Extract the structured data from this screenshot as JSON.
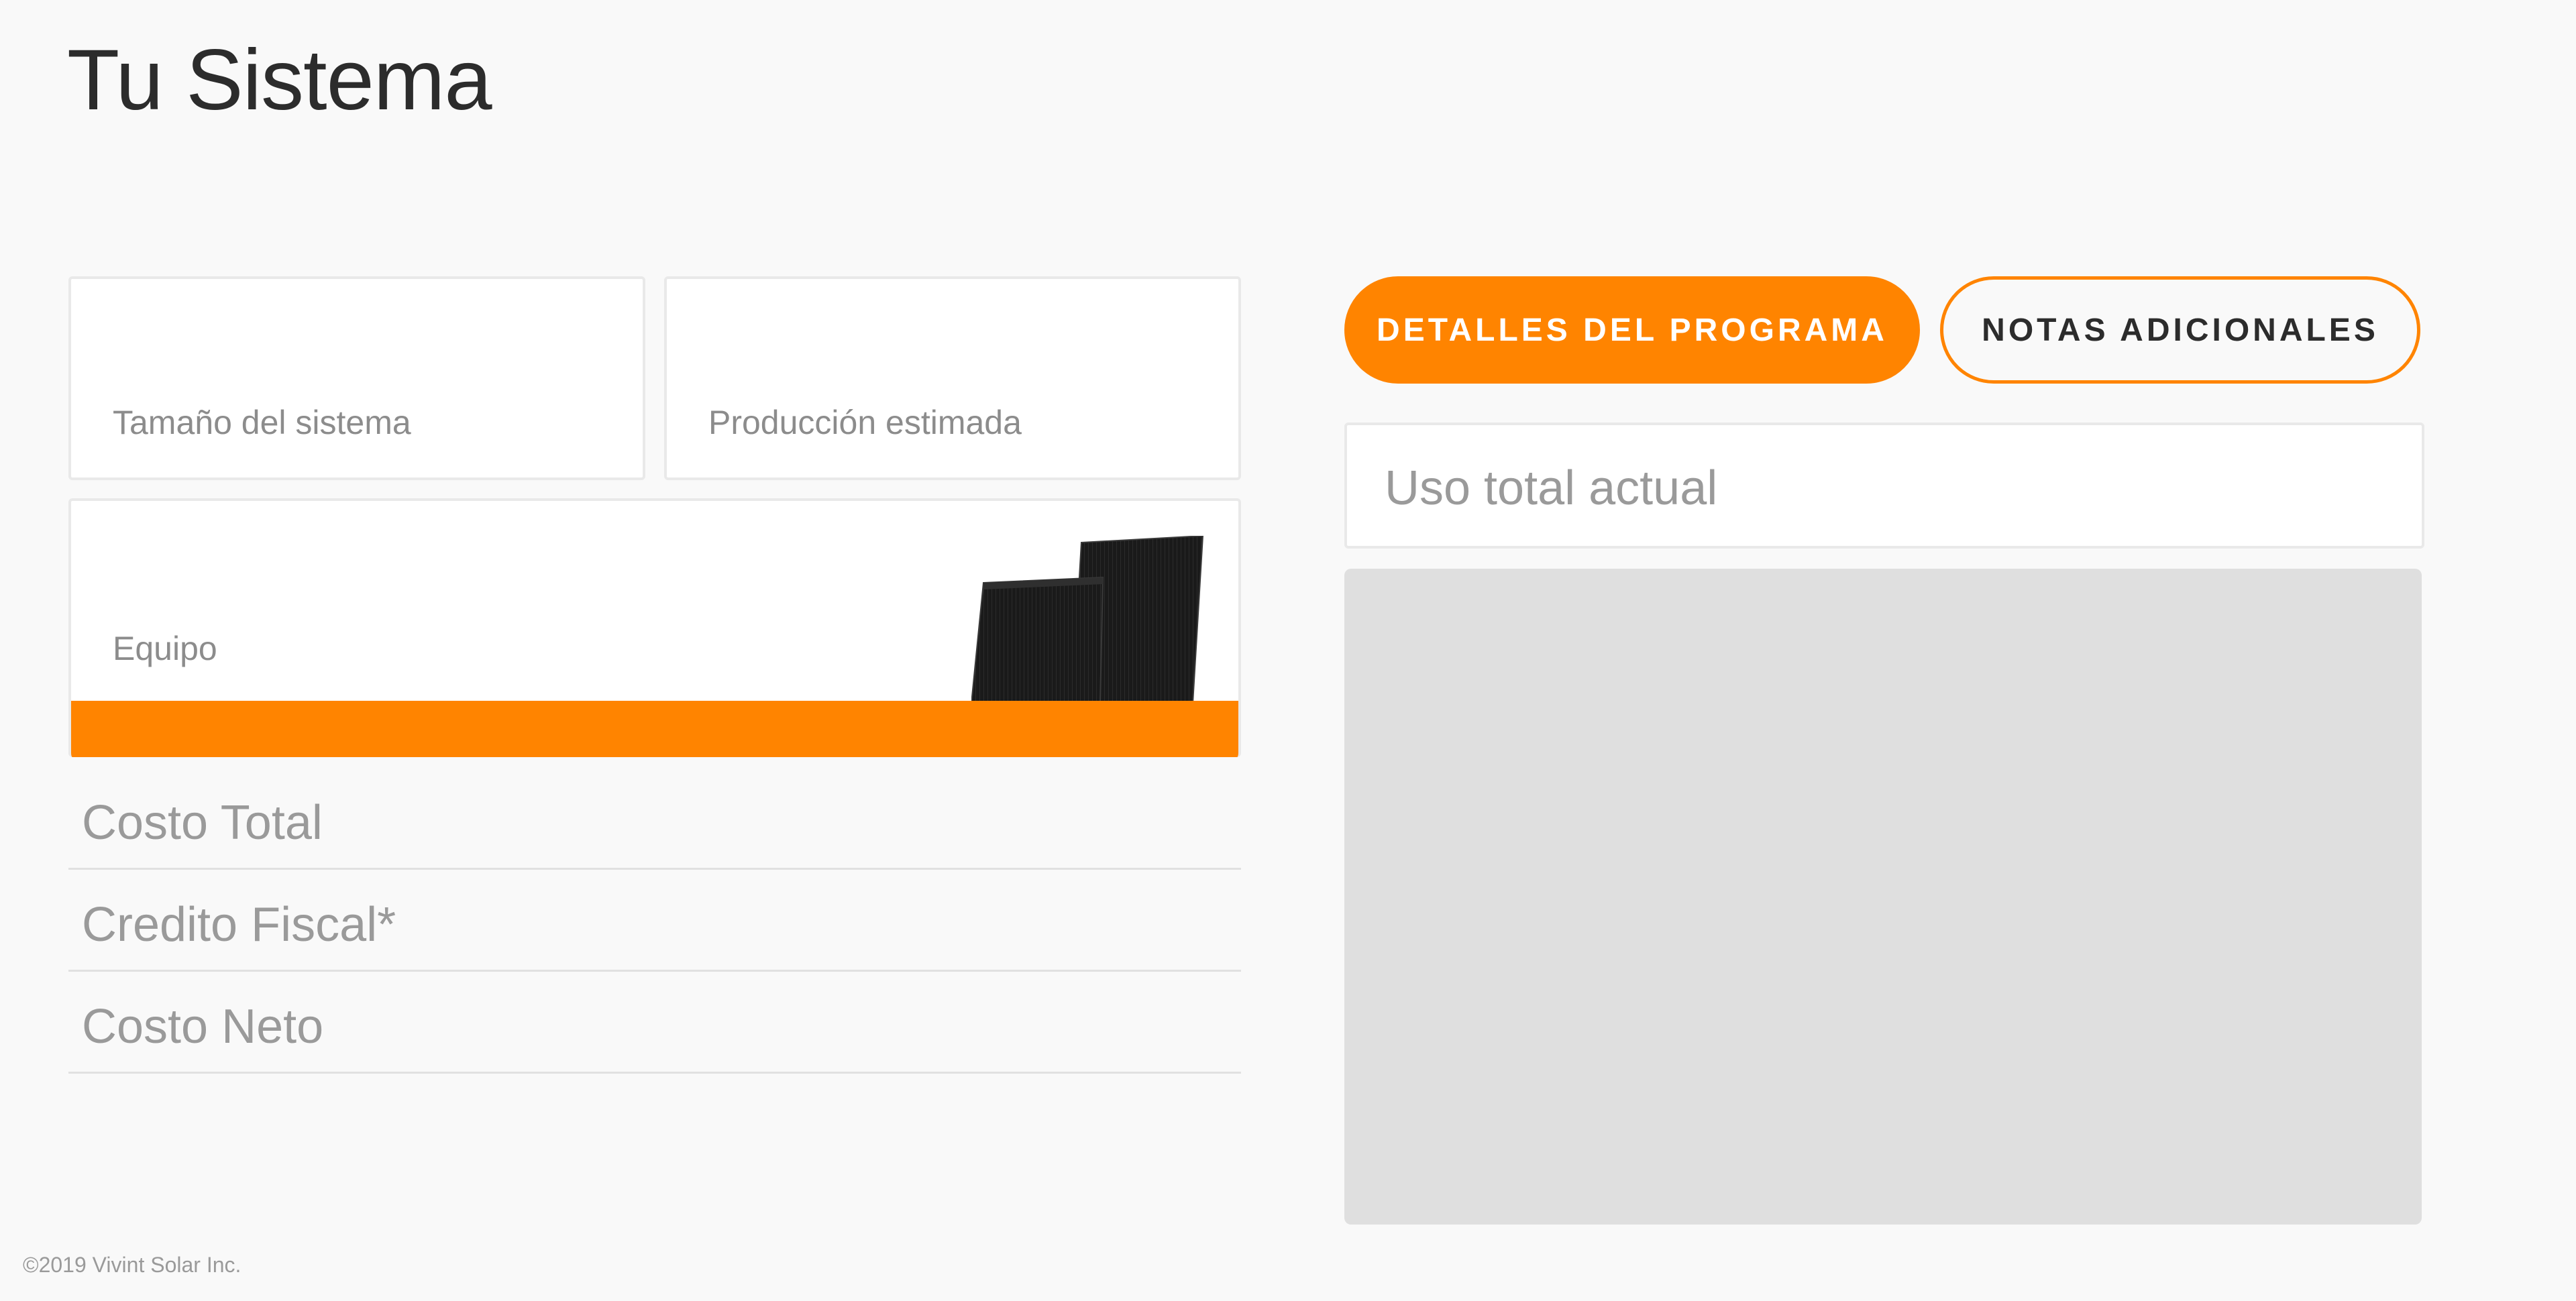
{
  "page": {
    "title": "Tu Sistema"
  },
  "cards": {
    "system_size_label": "Tamaño del sistema",
    "production_label": "Producción estimada",
    "equipment_label": "Equipo"
  },
  "costs": {
    "total_label": "Costo Total",
    "tax_credit_label": "Credito Fiscal*",
    "net_label": "Costo Neto"
  },
  "tabs": {
    "program_details_label": "DETALLES DEL PROGRAMA",
    "additional_notes_label": "NOTAS ADICIONALES"
  },
  "usage": {
    "label": "Uso total actual"
  },
  "footer": {
    "copyright": "©2019 Vivint Solar Inc."
  },
  "colors": {
    "accent": "#ff8400",
    "background": "#f9f9f9",
    "card": "#ffffff",
    "placeholder": "#dfdfdf"
  },
  "icons": {
    "equipment_image": "solar-panels-image"
  }
}
